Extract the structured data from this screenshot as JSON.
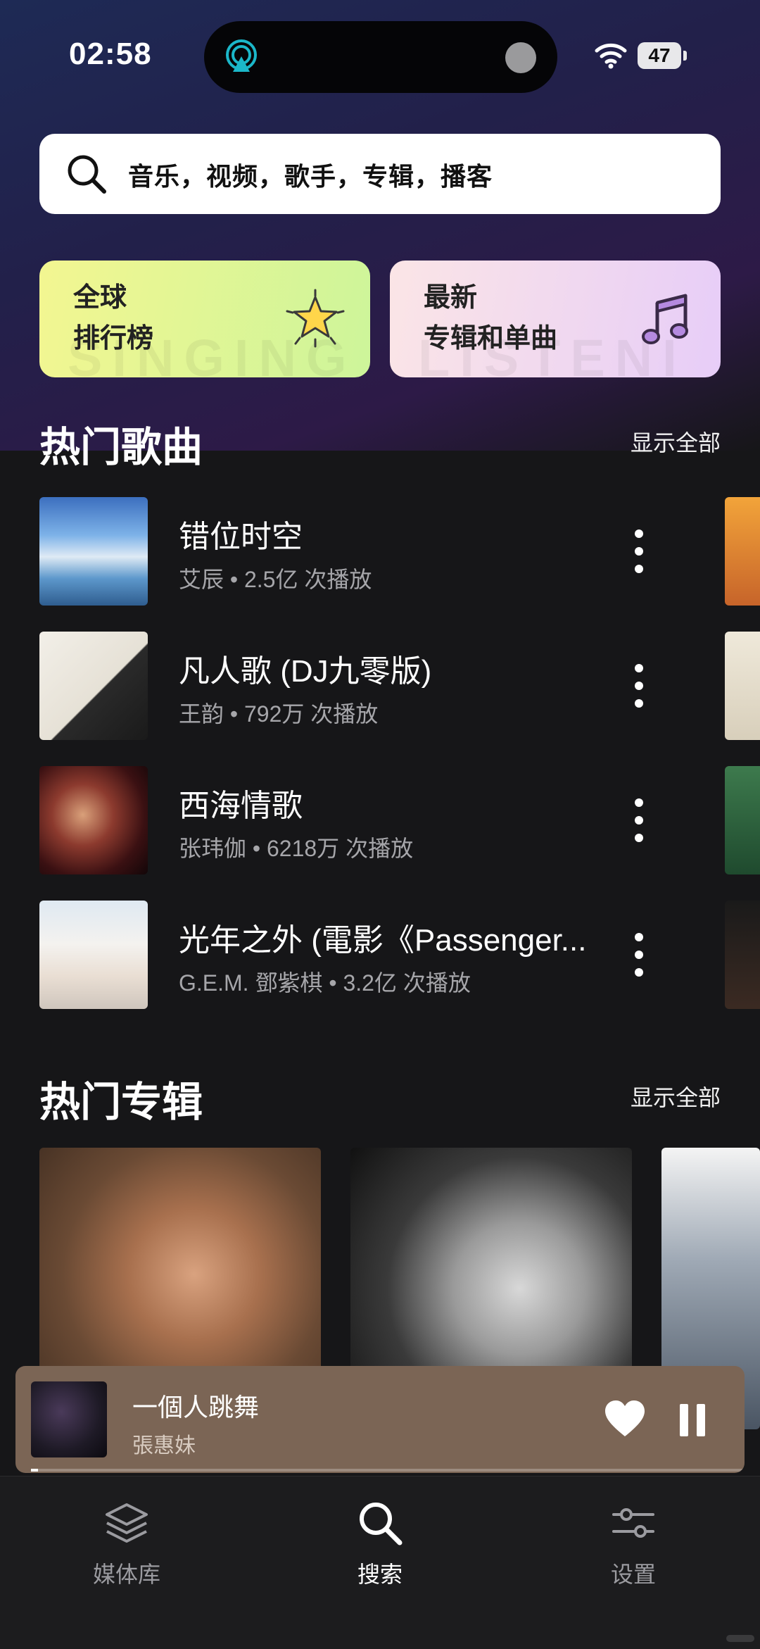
{
  "status": {
    "time": "02:58",
    "battery": "47"
  },
  "search": {
    "placeholder": "音乐，视频，歌手，专辑，播客"
  },
  "cards": [
    {
      "line1": "全球",
      "line2": "排行榜",
      "watermark": "SINGING"
    },
    {
      "line1": "最新",
      "line2": "专辑和单曲",
      "watermark": "LISTENI"
    }
  ],
  "hot_songs": {
    "title": "热门歌曲",
    "show_all": "显示全部",
    "items": [
      {
        "title": "错位时空",
        "subtitle": "艾辰 • 2.5亿 次播放"
      },
      {
        "title": "凡人歌 (DJ九零版)",
        "subtitle": "王韵 • 792万 次播放"
      },
      {
        "title": "西海情歌",
        "subtitle": "张玮伽 • 6218万 次播放"
      },
      {
        "title": "光年之外 (電影《Passenger...",
        "subtitle": "G.E.M. 鄧紫棋 • 3.2亿 次播放"
      }
    ]
  },
  "hot_albums": {
    "title": "热门专辑",
    "show_all": "显示全部"
  },
  "player": {
    "title": "一個人跳舞",
    "artist": "張惠妹",
    "progress": 0.01
  },
  "tabs": [
    {
      "label": "媒体库",
      "icon": "layers-icon"
    },
    {
      "label": "搜索",
      "icon": "search-icon"
    },
    {
      "label": "设置",
      "icon": "sliders-icon"
    }
  ],
  "colors": {
    "accent_airplay": "#1bb7c9",
    "player_bg": "#7b6555",
    "active_tab": "#ffffff",
    "inactive_tab": "#9b9ba0"
  }
}
